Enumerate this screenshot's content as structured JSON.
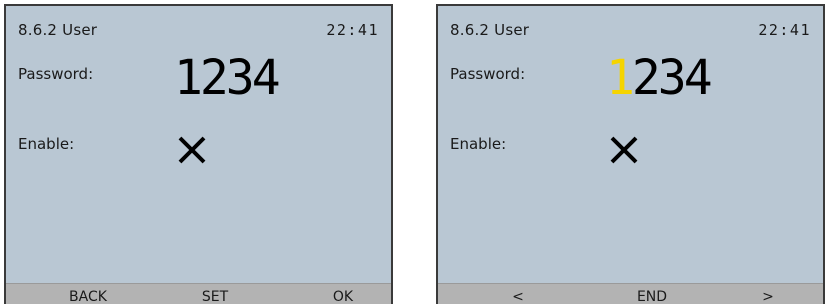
{
  "panels": [
    {
      "title": "8.6.2 User",
      "time": "22:41",
      "password_label": "Password:",
      "password_cursor": "",
      "password_rest": "1234",
      "enable_label": "Enable:",
      "enable_icon": "cross-icon",
      "softkeys": [
        "BACK",
        "SET",
        "OK"
      ]
    },
    {
      "title": "8.6.2 User",
      "time": "22:41",
      "password_label": "Password:",
      "password_cursor": "1",
      "password_rest": "234",
      "enable_label": "Enable:",
      "enable_icon": "cross-icon",
      "softkeys": [
        "<",
        "END",
        ">"
      ]
    }
  ],
  "colors": {
    "screen_bg": "#b9c7d3",
    "softkey_bar": "#b3b3b3",
    "cursor_digit": "#f5d400"
  }
}
